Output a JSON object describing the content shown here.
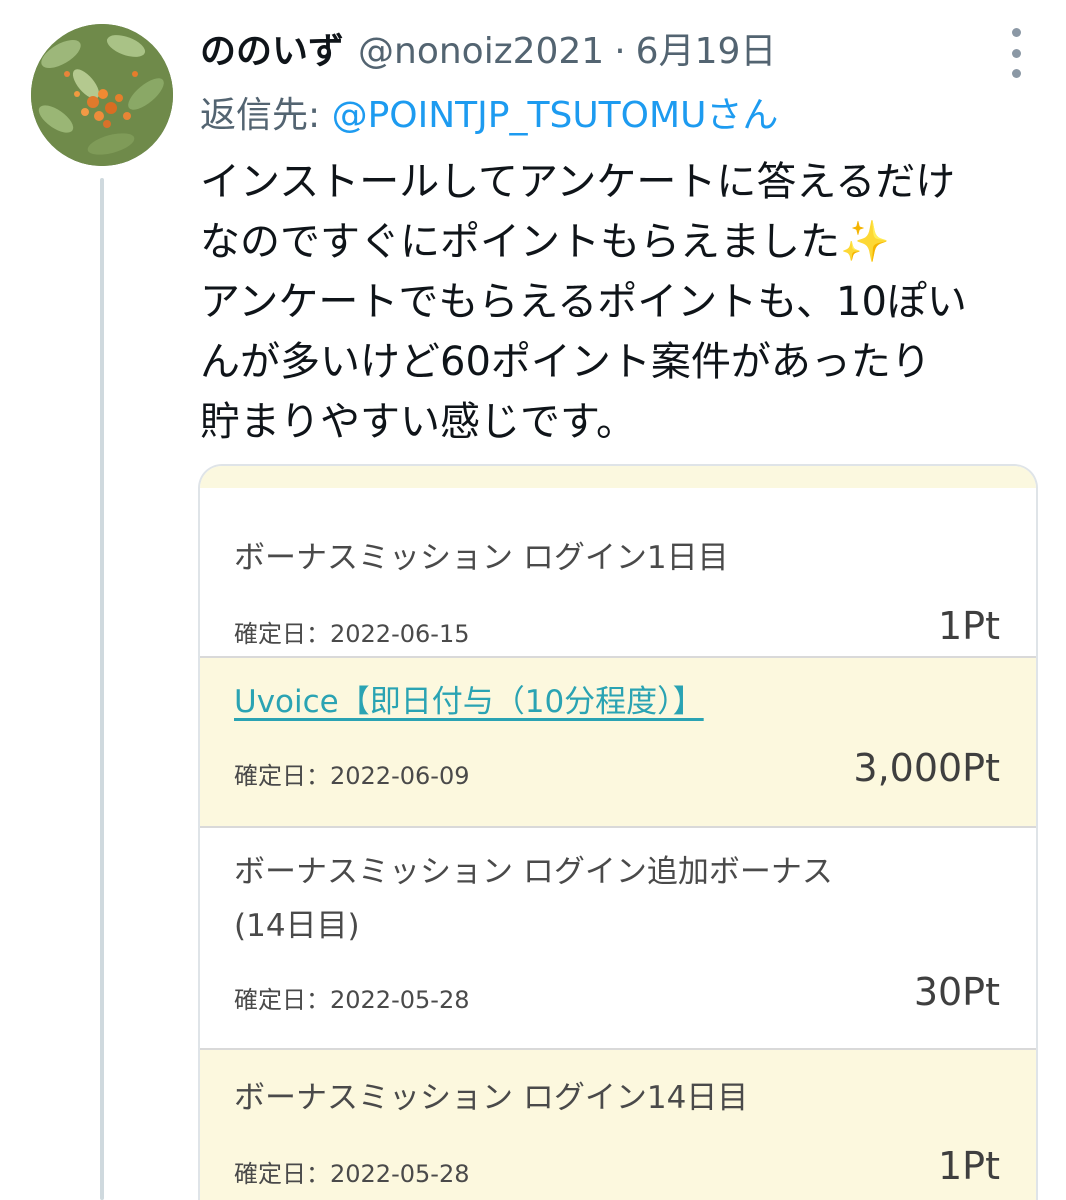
{
  "tweet": {
    "display_name": "ののいず",
    "handle": "@nonoiz2021",
    "separator": "·",
    "date": "6月19日",
    "reply_prefix": "返信先: ",
    "reply_mention": "@POINTJP_TSUTOMUさん",
    "text_lines": [
      "インストールしてアンケートに答えるだけ",
      "なのですぐにポイントもらえました",
      "アンケートでもらえるポイントも、10ぽい",
      "んが多いけど60ポイント案件があったり",
      "貯まりやすい感じです。"
    ],
    "emoji": "✨",
    "more_icon": "more-vertical-icon"
  },
  "history": {
    "date_label": "確定日：",
    "items": [
      {
        "title_lines": [
          "ボーナスミッション ログイン1日目"
        ],
        "date": "2022-06-15",
        "points": "1Pt",
        "is_link": false
      },
      {
        "title_lines": [
          "Uvoice【即日付与（10分程度）】"
        ],
        "date": "2022-06-09",
        "points": "3,000Pt",
        "is_link": true
      },
      {
        "title_lines": [
          "ボーナスミッション ログイン追加ボーナス",
          "(14日目)"
        ],
        "date": "2022-05-28",
        "points": "30Pt",
        "is_link": false
      },
      {
        "title_lines": [
          "ボーナスミッション ログイン14日目"
        ],
        "date": "2022-05-28",
        "points": "1Pt",
        "is_link": false
      }
    ]
  },
  "colors": {
    "link": "#1d9bf0",
    "card_link": "#2aa3b3",
    "cream_row": "#fcf8de",
    "muted": "#536471"
  }
}
